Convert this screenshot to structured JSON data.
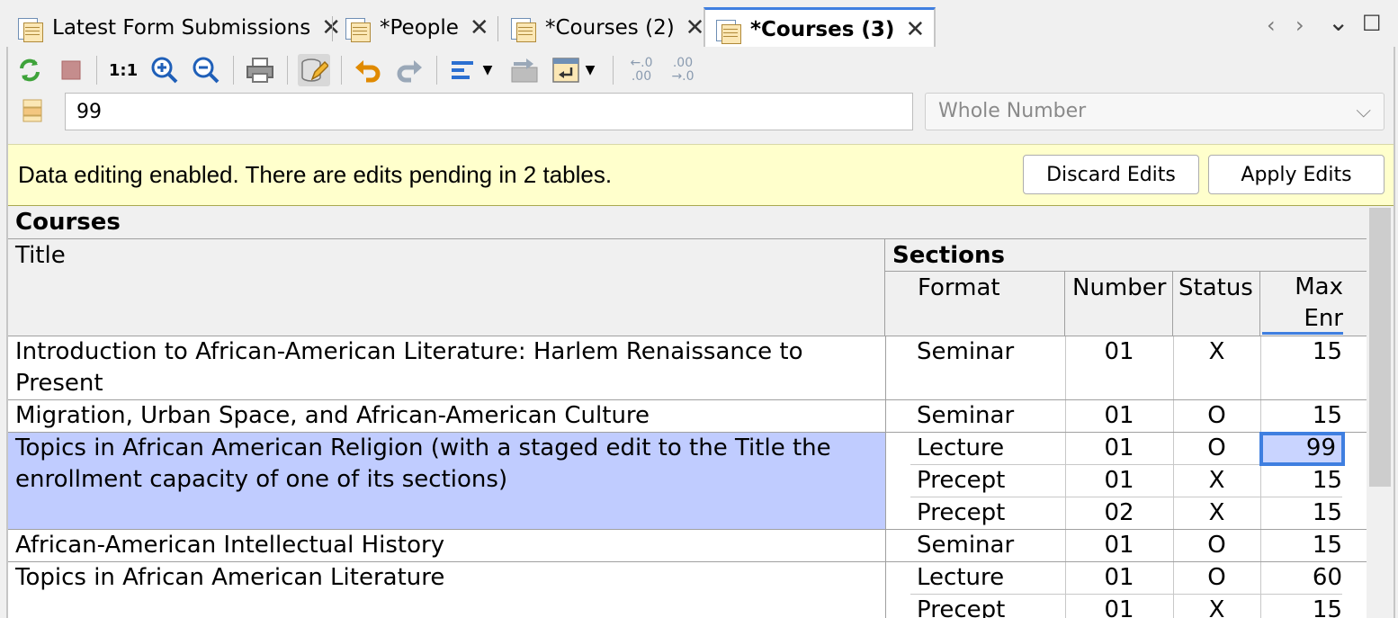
{
  "tabs": [
    {
      "label": "Latest Form Submissions",
      "active": false
    },
    {
      "label": "*People",
      "active": false
    },
    {
      "label": "*Courses (2)",
      "active": false
    },
    {
      "label": "*Courses (3)",
      "active": true
    }
  ],
  "tab_controls": {
    "prev": "‹",
    "next": "›",
    "menu": "⌄",
    "maximize": "☐"
  },
  "toolbar": {
    "zoom_reset_label": "1:1",
    "decimals_more_label": "←.0\n.00",
    "decimals_less_label": ".00\n→.0"
  },
  "formula": {
    "value": "99",
    "type_placeholder": "Whole Number"
  },
  "banner": {
    "message": "Data editing enabled. There are edits pending in 2 tables.",
    "discard_label": "Discard Edits",
    "apply_label": "Apply Edits"
  },
  "table": {
    "title": "Courses",
    "col_title": "Title",
    "col_sections": "Sections",
    "col_format": "Format",
    "col_number": "Number",
    "col_status": "Status",
    "col_maxenr": "Max Enr",
    "rows": [
      {
        "title": "Introduction to African-American Literature: Harlem Renaissance to Present",
        "sections": [
          {
            "format": "Seminar",
            "number": "01",
            "status": "X",
            "max": "15"
          }
        ]
      },
      {
        "title": "Migration, Urban Space, and African-American Culture",
        "sections": [
          {
            "format": "Seminar",
            "number": "01",
            "status": "O",
            "max": "15"
          }
        ]
      },
      {
        "title": "Topics in African American Religion (with a staged edit to the Title the enrollment capacity of one of its sections)",
        "sections": [
          {
            "format": "Lecture",
            "number": "01",
            "status": "O",
            "max": "99"
          },
          {
            "format": "Precept",
            "number": "01",
            "status": "X",
            "max": "15"
          },
          {
            "format": "Precept",
            "number": "02",
            "status": "X",
            "max": "15"
          }
        ]
      },
      {
        "title": "African-American Intellectual History",
        "sections": [
          {
            "format": "Seminar",
            "number": "01",
            "status": "O",
            "max": "15"
          }
        ]
      },
      {
        "title": "Topics in African American Literature",
        "sections": [
          {
            "format": "Lecture",
            "number": "01",
            "status": "O",
            "max": "60"
          },
          {
            "format": "Precept",
            "number": "01",
            "status": "X",
            "max": "15"
          }
        ]
      }
    ]
  }
}
